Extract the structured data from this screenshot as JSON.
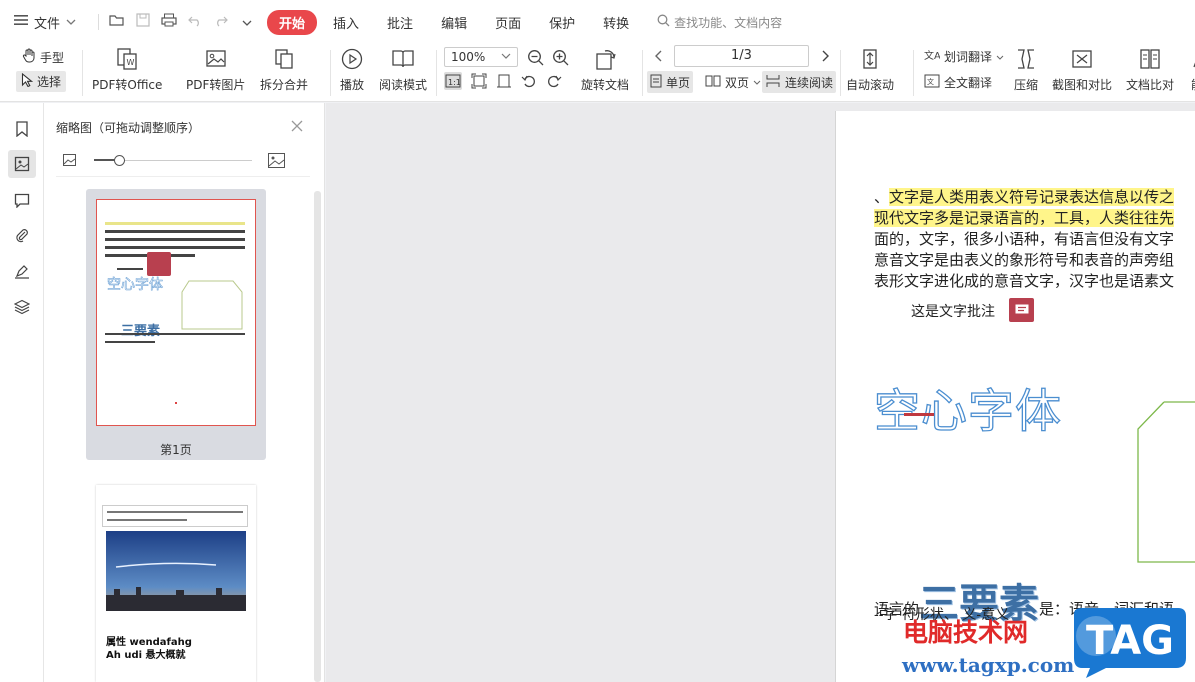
{
  "menubar": {
    "file_label": "文件",
    "tabs": [
      {
        "label": "开始",
        "active": true
      },
      {
        "label": "插入",
        "active": false
      },
      {
        "label": "批注",
        "active": false
      },
      {
        "label": "编辑",
        "active": false
      },
      {
        "label": "页面",
        "active": false
      },
      {
        "label": "保护",
        "active": false
      },
      {
        "label": "转换",
        "active": false
      }
    ],
    "search_placeholder": "查找功能、文档内容"
  },
  "ribbon": {
    "hand_tool": "手型",
    "select_tool": "选择",
    "pdf_to_office": "PDF转Office",
    "pdf_to_image": "PDF转图片",
    "split_merge": "拆分合并",
    "play": "播放",
    "read_mode": "阅读模式",
    "zoom": "100%",
    "rotate_doc": "旋转文档",
    "page_indicator": "1/3",
    "single_page": "单页",
    "double_page": "双页",
    "continuous": "连续阅读",
    "auto_scroll": "自动滚动",
    "word_translate": "划词翻译",
    "full_translate": "全文翻译",
    "compress": "压缩",
    "screenshot_compare": "截图和对比",
    "doc_compare": "文档比对",
    "cut_off": "能"
  },
  "panel": {
    "title": "缩略图（可拖动调整顺序）",
    "page1_label": "第1页",
    "thumb2_text1": "属性 wendafahg",
    "thumb2_text2": "Ah udi 悬大概就"
  },
  "document": {
    "line1_prefix": "、",
    "line1_highlight": "文字是人类用表义符号记录表达信息以传之",
    "line2_highlight": "现代文字多是记录语言的，工具，人类往往先",
    "line3": "面的，文字，很多小语种，有语言但没有文字",
    "line4": "意音文字是由表义的象形符号和表音的声旁组",
    "line5": "表形文字进化成的意音文字，汉字也是语素文",
    "note_text": "这是文字批注",
    "hollow_text": "空心字体",
    "sentence_pre": "语言的",
    "sentence_big": "三要素",
    "sentence_post": "是：语音、词汇和语",
    "sentence2": "--字  符形状、 义-意义"
  },
  "watermark": {
    "line1": "电脑技术网",
    "line2": "www.tagxp.com",
    "badge": "TAG"
  },
  "colors": {
    "accent": "#e9474b",
    "comment": "#b8404f",
    "highlight": "#fff58a",
    "hollow_stroke": "#4b8ed0"
  }
}
